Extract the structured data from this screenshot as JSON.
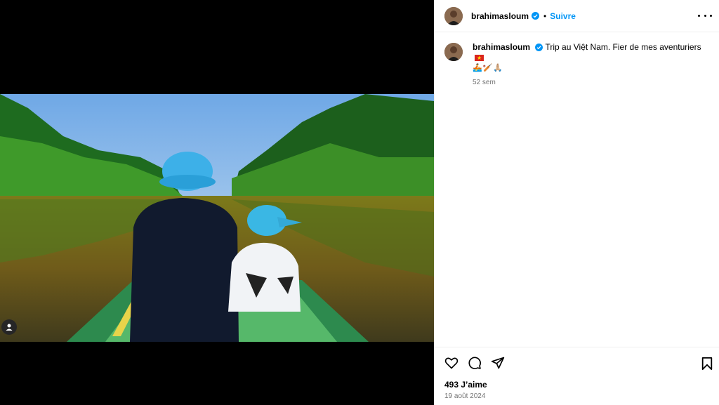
{
  "post": {
    "username": "brahimasloum",
    "follow_label": "Suivre",
    "separator": "•",
    "caption": "Trip au Việt Nam. Fier de mes aventuriers",
    "caption_emojis": "🚣🏏🙏🏼",
    "time_ago": "52 sem",
    "likes": "493 J’aime",
    "date": "19 août 2024"
  },
  "icons": {
    "verified": "verified-badge-icon",
    "more": "more-options-icon",
    "like": "heart-icon",
    "comment": "comment-icon",
    "share": "share-icon",
    "save": "bookmark-icon",
    "tag": "user-tag-icon"
  },
  "colors": {
    "accent": "#0095f6",
    "verified": "#0095f6",
    "muted": "#737373"
  }
}
